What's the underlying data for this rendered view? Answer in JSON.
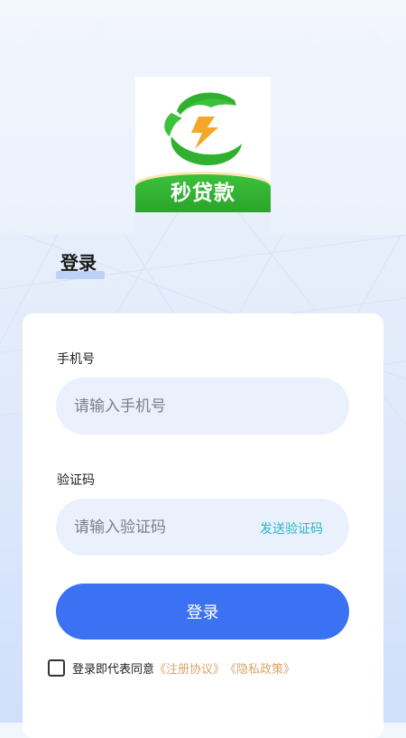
{
  "app": {
    "logo_text": "秒贷款",
    "logo_icon": "lightning-icon",
    "colors": {
      "brand_green": "#3cc13b",
      "accent_orange": "#f5a72b",
      "primary_blue": "#3a72f3",
      "link_cyan": "#29b5c6",
      "link_gold": "#d9a46a"
    }
  },
  "tab": {
    "title": "登录"
  },
  "form": {
    "phone_label": "手机号",
    "phone_placeholder": "请输入手机号",
    "phone_value": "",
    "code_label": "验证码",
    "code_placeholder": "请输入验证码",
    "code_value": "",
    "send_code_label": "发送验证码",
    "login_label": "登录",
    "agreement_prefix": "登录即代表同意",
    "agreement_link": "《注册协议》",
    "privacy_link": "《隐私政策》"
  }
}
